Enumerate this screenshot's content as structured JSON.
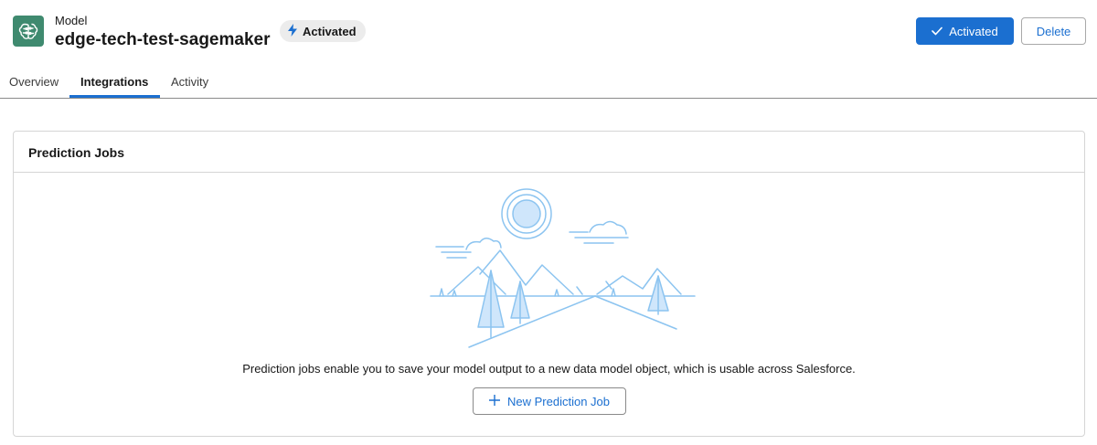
{
  "header": {
    "eyebrow": "Model",
    "title": "edge-tech-test-sagemaker",
    "status_badge": "Activated",
    "activated_button": "Activated",
    "delete_button": "Delete"
  },
  "tabs": [
    {
      "label": "Overview",
      "active": false
    },
    {
      "label": "Integrations",
      "active": true
    },
    {
      "label": "Activity",
      "active": false
    }
  ],
  "prediction_jobs": {
    "title": "Prediction Jobs",
    "empty_message": "Prediction jobs enable you to save your model output to a new data model object, which is usable across Salesforce.",
    "new_button": "New Prediction Job"
  },
  "colors": {
    "brand": "#1b6fd0",
    "model_icon": "#3f8a6f",
    "illustration_stroke": "#8cc4f0",
    "illustration_fill": "#cfe6fb"
  },
  "icons": {
    "model": "brain-icon",
    "badge": "lightning-bolt-icon",
    "activated": "check-icon",
    "new_job": "plus-icon"
  }
}
